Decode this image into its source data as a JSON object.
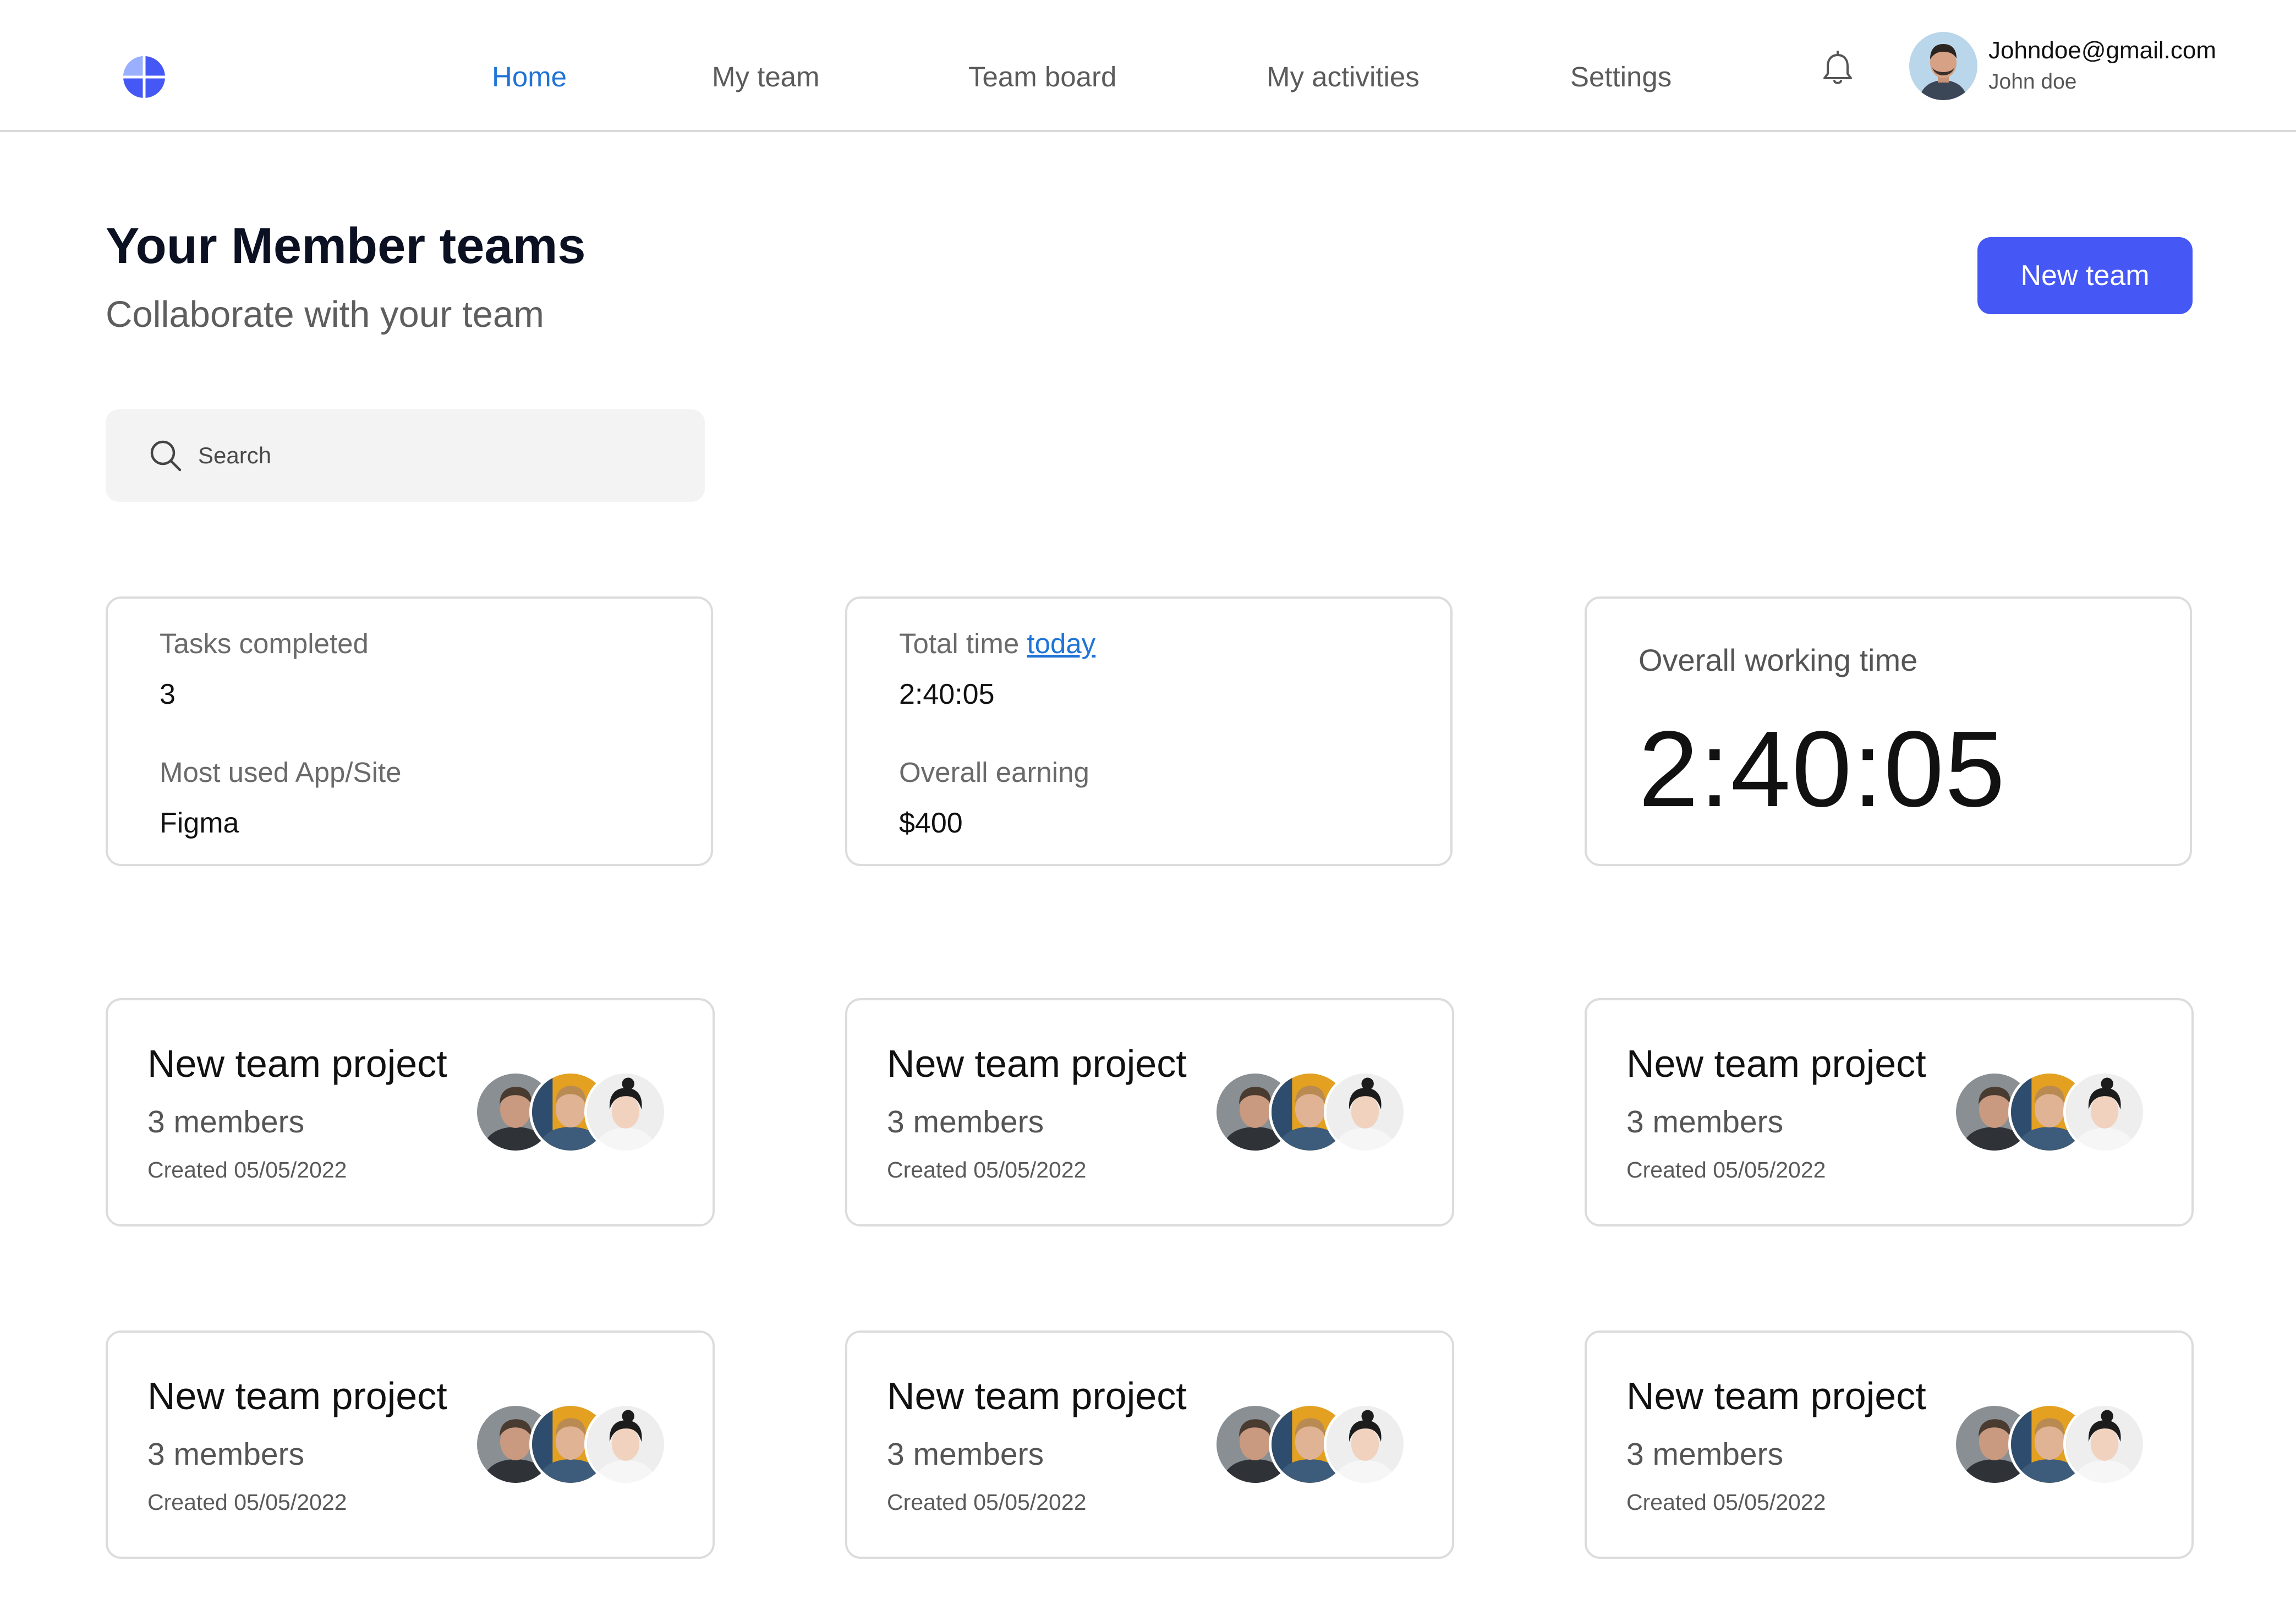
{
  "nav": {
    "items": [
      {
        "label": "Home",
        "active": true
      },
      {
        "label": "My team",
        "active": false
      },
      {
        "label": "Team board",
        "active": false
      },
      {
        "label": "My activities",
        "active": false
      },
      {
        "label": "Settings",
        "active": false
      }
    ],
    "icons": {
      "logo": "pie-logo-icon",
      "notifications": "bell-icon"
    }
  },
  "profile": {
    "email": "Johndoe@gmail.com",
    "name": "John doe"
  },
  "header": {
    "title": "Your Member teams",
    "subtitle": "Collaborate with your team",
    "new_team_label": "New team"
  },
  "search": {
    "placeholder": "Search",
    "value": ""
  },
  "stats": {
    "card1": {
      "tasks_label": "Tasks completed",
      "tasks_value": "3",
      "app_label": "Most used App/Site",
      "app_value": "Figma"
    },
    "card2": {
      "time_label": "Total time",
      "time_link": "today",
      "time_value": "2:40:05",
      "earning_label": "Overall earning",
      "earning_value": "$400"
    },
    "card3": {
      "label": "Overall working time",
      "value": "2:40:05"
    }
  },
  "teams": [
    {
      "title": "New team project",
      "members": "3 members",
      "created": "Created 05/05/2022"
    },
    {
      "title": "New team project",
      "members": "3 members",
      "created": "Created 05/05/2022"
    },
    {
      "title": "New team project",
      "members": "3 members",
      "created": "Created 05/05/2022"
    },
    {
      "title": "New team project",
      "members": "3 members",
      "created": "Created 05/05/2022"
    },
    {
      "title": "New team project",
      "members": "3 members",
      "created": "Created 05/05/2022"
    },
    {
      "title": "New team project",
      "members": "3 members",
      "created": "Created 05/05/2022"
    }
  ],
  "colors": {
    "accent": "#4557f5",
    "active_nav": "#1f74d6",
    "border": "#dcdcdc",
    "search_bg": "#f3f3f3"
  }
}
